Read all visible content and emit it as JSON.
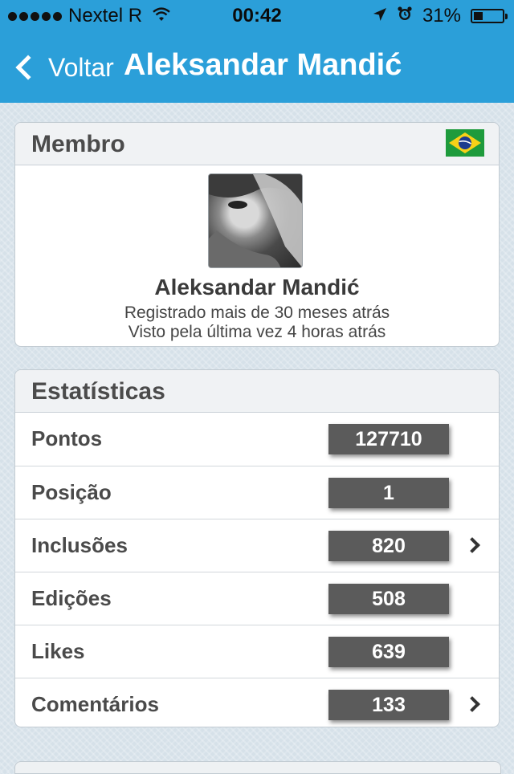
{
  "status_bar": {
    "carrier": "Nextel R",
    "time": "00:42",
    "battery_percent": "31%",
    "battery_level": 0.31,
    "icons": [
      "signal-dots-icon",
      "wifi-icon",
      "location-arrow-icon",
      "alarm-clock-icon",
      "battery-icon"
    ]
  },
  "nav": {
    "back_label": "Voltar",
    "title": "Aleksandar Mandić"
  },
  "member": {
    "header": "Membro",
    "flag": "brazil-flag-icon",
    "name": "Aleksandar Mandić",
    "registered": "Registrado mais de 30 meses atrás",
    "last_seen": "Visto pela última vez 4 horas atrás"
  },
  "stats": {
    "header": "Estatísticas",
    "rows": [
      {
        "label": "Pontos",
        "value": "127710",
        "has_chevron": false
      },
      {
        "label": "Posição",
        "value": "1",
        "has_chevron": false
      },
      {
        "label": "Inclusões",
        "value": "820",
        "has_chevron": true
      },
      {
        "label": "Edições",
        "value": "508",
        "has_chevron": false
      },
      {
        "label": "Likes",
        "value": "639",
        "has_chevron": false
      },
      {
        "label": "Comentários",
        "value": "133",
        "has_chevron": true
      }
    ]
  },
  "colors": {
    "nav_blue": "#2b9fd9",
    "value_badge": "#5b5b5b",
    "background": "#d6e1e9"
  }
}
